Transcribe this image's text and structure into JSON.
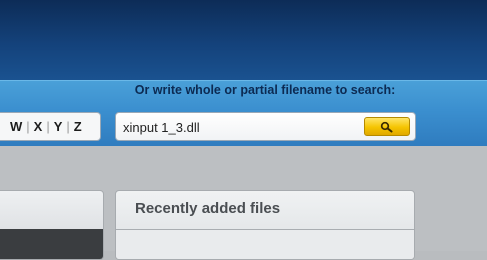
{
  "search": {
    "hint": "Or write whole or partial filename to search:",
    "value": "xinput 1_3.dll",
    "button_icon": "search-icon"
  },
  "letters": [
    "W",
    "X",
    "Y",
    "Z"
  ],
  "recent": {
    "title": "Recently added files"
  },
  "colors": {
    "header": "#14427b",
    "search_band": "#3b8fcf",
    "search_button": "#f5c400",
    "background": "#bcbfc2"
  }
}
